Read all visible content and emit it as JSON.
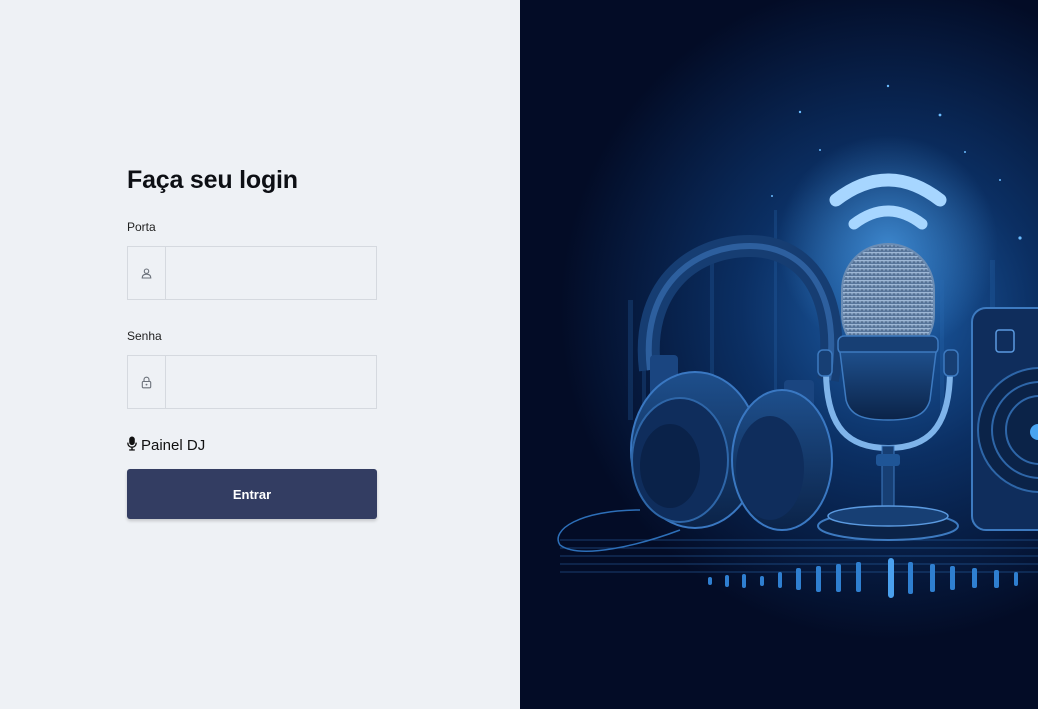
{
  "login": {
    "title": "Faça seu login",
    "port_label": "Porta",
    "port_value": "",
    "password_label": "Senha",
    "password_value": "",
    "panel_label": "Painel DJ",
    "submit_label": "Entrar"
  },
  "icons": {
    "port": "user-icon",
    "password": "lock-icon",
    "panel": "microphone-icon"
  },
  "colors": {
    "page_bg": "#eef1f5",
    "button": "#333d62",
    "hero_bg": "#04112e",
    "hero_glow": "#1f6fc4"
  }
}
